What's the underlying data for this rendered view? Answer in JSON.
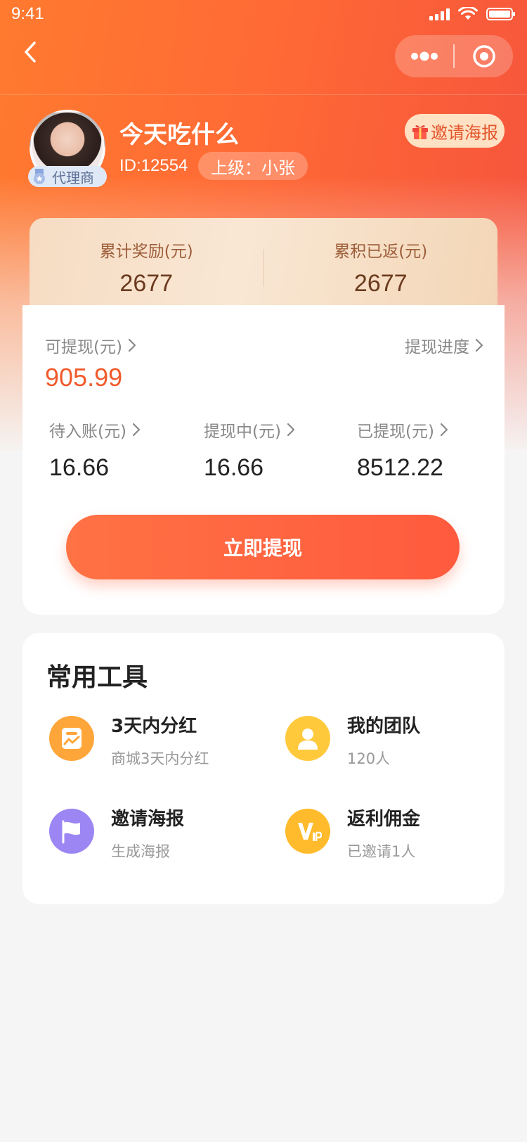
{
  "status_bar": {
    "time": "9:41"
  },
  "profile": {
    "name": "今天吃什么",
    "id": "ID:12554",
    "superior": "上级：小张",
    "badge": "代理商",
    "invite_poster": "邀请海报"
  },
  "rewards": {
    "total_label": "累计奖励(元)",
    "total_value": "2677",
    "returned_label": "累积已返(元)",
    "returned_value": "2677"
  },
  "balance": {
    "available_label": "可提现(元)",
    "available_value": "905.99",
    "progress_label": "提现进度",
    "stats": [
      {
        "label": "待入账(元)",
        "value": "16.66"
      },
      {
        "label": "提现中(元)",
        "value": "16.66"
      },
      {
        "label": "已提现(元)",
        "value": "8512.22"
      }
    ],
    "withdraw_button": "立即提现"
  },
  "tools": {
    "title": "常用工具",
    "items": [
      {
        "title": "3天内分红",
        "subtitle": "商城3天内分红",
        "icon": "dividend-chart-icon",
        "color": "#ffa63a"
      },
      {
        "title": "我的团队",
        "subtitle": "120人",
        "icon": "team-person-icon",
        "color": "#ffc93c"
      },
      {
        "title": "邀请海报",
        "subtitle": "生成海报",
        "icon": "flag-icon",
        "color": "#9b86f4"
      },
      {
        "title": "返利佣金",
        "subtitle": "已邀请1人",
        "icon": "vip-icon",
        "color": "#ffbb2c"
      }
    ]
  },
  "colors": {
    "brand": "#ff6a35",
    "accent_amount": "#f05a2b"
  }
}
